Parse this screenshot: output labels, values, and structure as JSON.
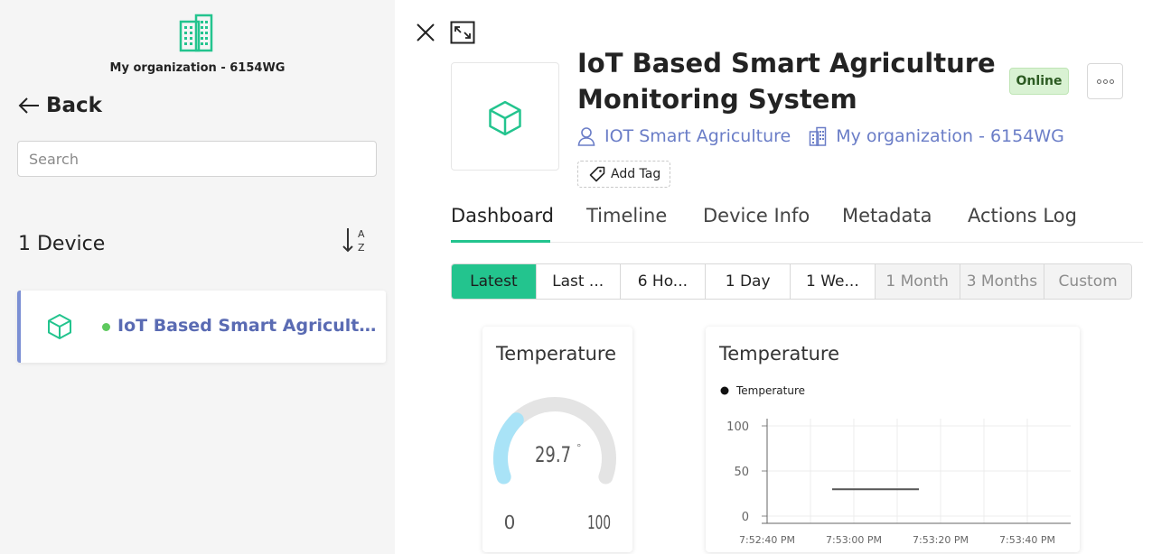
{
  "sidebar": {
    "org_name": "My organization - 6154WG",
    "back_label": "Back",
    "search_placeholder": "Search",
    "device_count": "1 Device",
    "devices": [
      {
        "name": "IoT Based Smart Agriculture Monitoring System",
        "status": "online"
      }
    ]
  },
  "device": {
    "title": "IoT Based Smart Agriculture Monitoring System",
    "status": "Online",
    "template": "IOT Smart Agriculture",
    "organization": "My organization - 6154WG",
    "add_tag_label": "Add Tag"
  },
  "tabs": [
    {
      "label": "Dashboard",
      "active": true
    },
    {
      "label": "Timeline",
      "active": false
    },
    {
      "label": "Device Info",
      "active": false
    },
    {
      "label": "Metadata",
      "active": false
    },
    {
      "label": "Actions Log",
      "active": false
    }
  ],
  "time_ranges": [
    {
      "label": "Latest",
      "state": "active"
    },
    {
      "label": "Last ...",
      "state": "normal"
    },
    {
      "label": "6 Ho...",
      "state": "normal"
    },
    {
      "label": "1 Day",
      "state": "normal"
    },
    {
      "label": "1 We...",
      "state": "normal"
    },
    {
      "label": "1 Month",
      "state": "disabled"
    },
    {
      "label": "3 Months",
      "state": "disabled"
    },
    {
      "label": "Custom",
      "state": "disabled"
    }
  ],
  "widgets": {
    "gauge": {
      "title": "Temperature",
      "value": "29.7",
      "unit": "°",
      "min": "0",
      "max": "100",
      "fraction": 0.297
    },
    "chart": {
      "title": "Temperature",
      "legend": "Temperature"
    }
  },
  "chart_data": {
    "type": "line",
    "title": "Temperature",
    "xlabel": "",
    "ylabel": "",
    "legend_placement": "top-left",
    "grid": true,
    "ylim": [
      0,
      100
    ],
    "yticks": [
      "100",
      "50",
      "0"
    ],
    "xticks": [
      "7:52:40 PM",
      "7:53:00 PM",
      "7:53:20 PM",
      "7:53:40 PM"
    ],
    "series": [
      {
        "name": "Temperature",
        "x": [
          "7:52:55 PM",
          "7:53:15 PM"
        ],
        "y": [
          29.7,
          29.7
        ]
      }
    ]
  },
  "colors": {
    "accent": "#23c48e",
    "link": "#6a7dc7",
    "status_online": "#5ec95e",
    "gauge_fill": "#a9e3f7",
    "gauge_track": "#e4e4e4"
  },
  "icons": {
    "org": "building-icon",
    "back": "arrow-left-icon",
    "sort": "sort-az-icon",
    "device": "cube-icon",
    "close": "close-icon",
    "expand": "expand-icon",
    "more": "more-dots-icon",
    "template": "user-icon",
    "tag": "tag-icon"
  }
}
